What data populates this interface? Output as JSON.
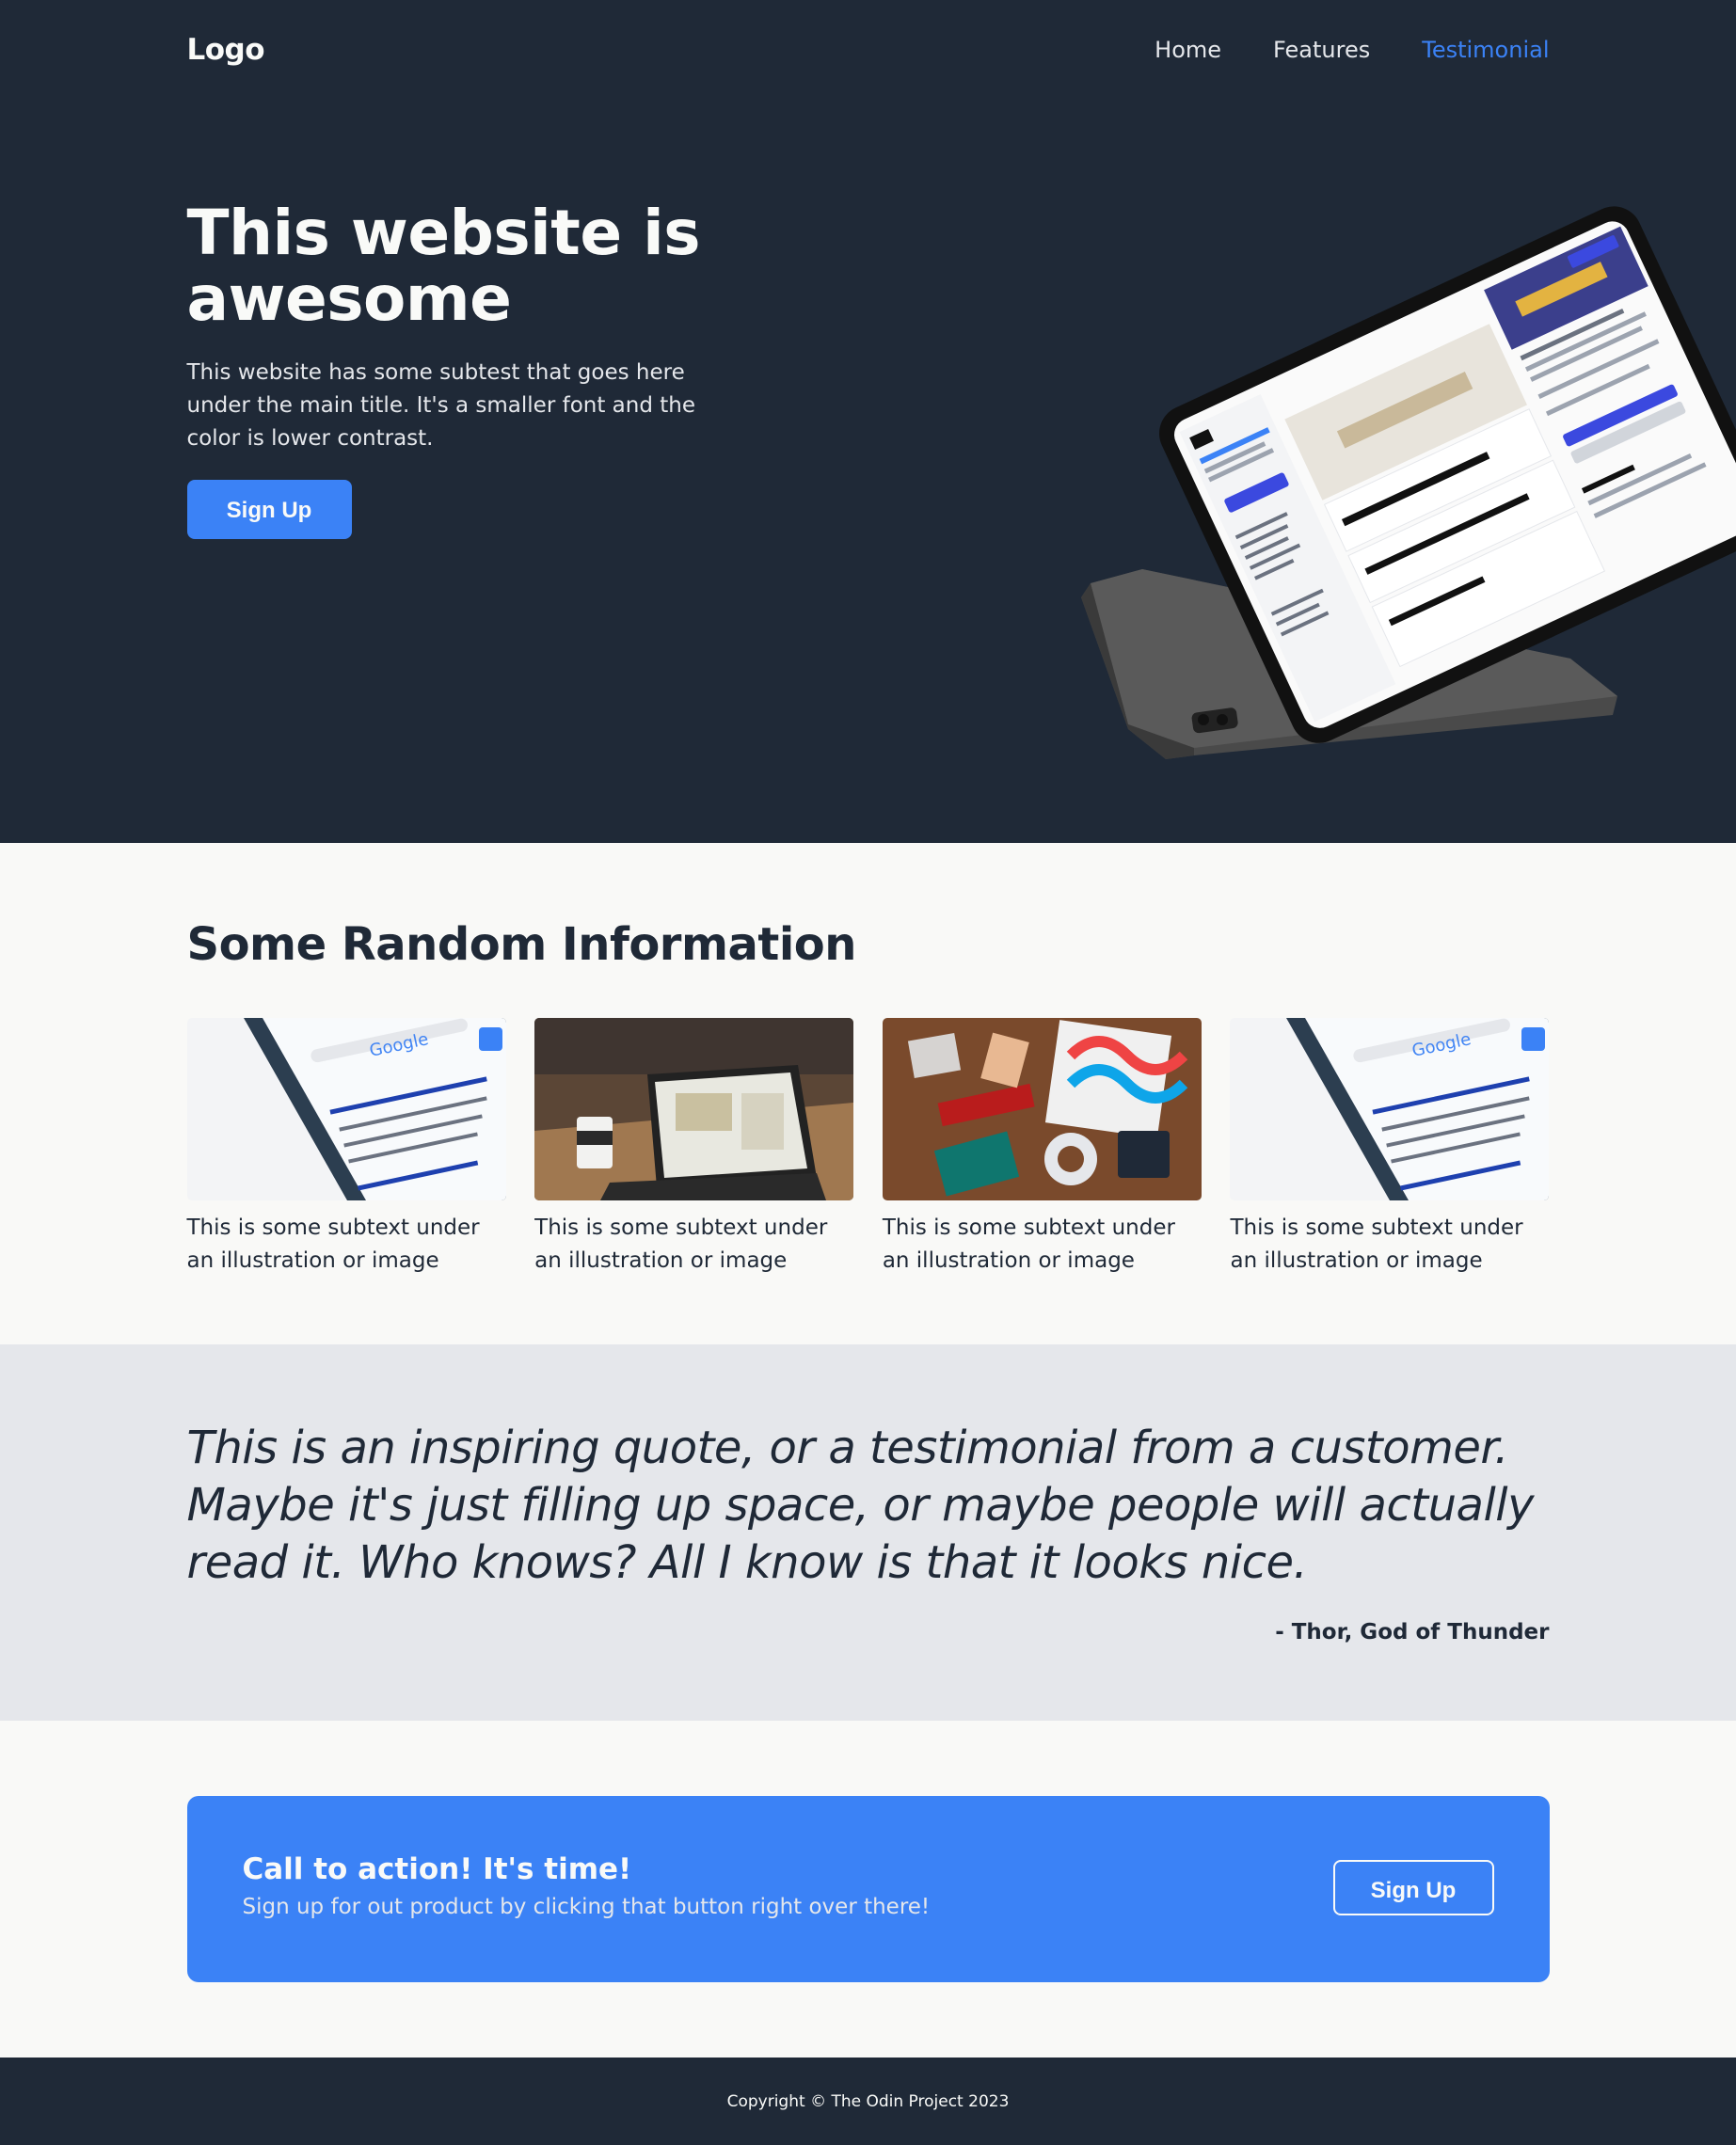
{
  "colors": {
    "dark": "#1f2937",
    "accent": "#3b82f6",
    "light": "#f9faf8",
    "muted": "#e5e7eb",
    "quote_bg": "#e5e7eb"
  },
  "nav": {
    "logo": "Logo",
    "links": [
      {
        "label": "Home",
        "active": false
      },
      {
        "label": "Features",
        "active": false
      },
      {
        "label": "Testimonial",
        "active": true
      }
    ]
  },
  "hero": {
    "title": "This website is awesome",
    "subtitle": "This website has some subtest that goes here under the main title. It's a smaller font and the color is lower contrast.",
    "button": "Sign Up",
    "image_icon": "tablet-screenshot-image"
  },
  "info": {
    "title": "Some Random Information",
    "cards": [
      {
        "text": "This is some subtext under an illustration or image",
        "image_icon": "phone-google-search-image"
      },
      {
        "text": "This is some subtext under an illustration or image",
        "image_icon": "laptop-coffee-image"
      },
      {
        "text": "This is some subtext under an illustration or image",
        "image_icon": "desk-flatlay-image"
      },
      {
        "text": "This is some subtext under an illustration or image",
        "image_icon": "phone-google-search-image"
      }
    ]
  },
  "quote": {
    "text": "This is an inspiring quote, or a testimonial from a customer. Maybe it's just filling up space, or maybe people will actually read it. Who knows? All I know is that it looks nice.",
    "author": "- Thor, God of Thunder"
  },
  "cta": {
    "title": "Call to action! It's time!",
    "subtitle": "Sign up for out product by clicking that button right over there!",
    "button": "Sign Up"
  },
  "footer": {
    "text": "Copyright © The Odin Project 2023"
  }
}
